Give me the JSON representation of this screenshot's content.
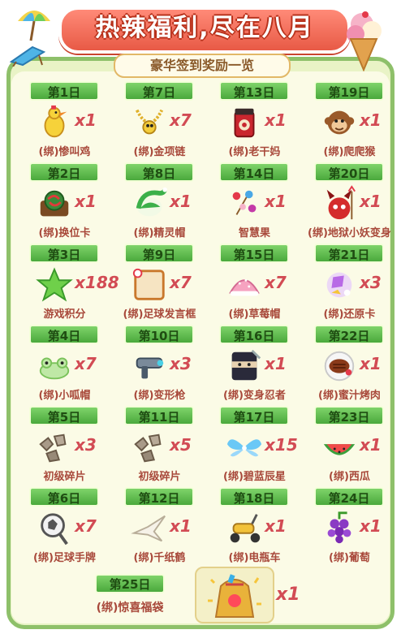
{
  "header": {
    "title": "热辣福利,尽在八月",
    "subtitle": "豪华签到奖励一览"
  },
  "colors": {
    "day_tag": "#4aa93c",
    "qty_text": "#d24b54",
    "name_text": "#a8483a",
    "banner": "#e85a46",
    "frame": "#8ec06a"
  },
  "rewards": [
    {
      "day": "第1日",
      "name": "(绑)惨叫鸡",
      "qty": "x1",
      "icon": "rubber-chicken-icon"
    },
    {
      "day": "第7日",
      "name": "(绑)金项链",
      "qty": "x7",
      "icon": "gold-necklace-icon"
    },
    {
      "day": "第13日",
      "name": "(绑)老干妈",
      "qty": "x1",
      "icon": "chili-sauce-jar-icon"
    },
    {
      "day": "第19日",
      "name": "(绑)爬爬猴",
      "qty": "x1",
      "icon": "monkey-icon"
    },
    {
      "day": "第2日",
      "name": "(绑)换位卡",
      "qty": "x1",
      "icon": "swap-card-icon"
    },
    {
      "day": "第8日",
      "name": "(绑)精灵帽",
      "qty": "x1",
      "icon": "elf-hat-icon"
    },
    {
      "day": "第14日",
      "name": "智慧果",
      "qty": "x1",
      "icon": "wisdom-fruit-icon"
    },
    {
      "day": "第20日",
      "name": "(绑)地狱小妖变身",
      "qty": "x1",
      "icon": "little-devil-icon"
    },
    {
      "day": "第3日",
      "name": "游戏积分",
      "qty": "x188",
      "icon": "green-star-icon"
    },
    {
      "day": "第9日",
      "name": "(绑)足球发言框",
      "qty": "x7",
      "icon": "chat-frame-icon"
    },
    {
      "day": "第15日",
      "name": "(绑)草莓帽",
      "qty": "x7",
      "icon": "strawberry-hat-icon"
    },
    {
      "day": "第21日",
      "name": "(绑)还原卡",
      "qty": "x3",
      "icon": "restore-card-icon"
    },
    {
      "day": "第4日",
      "name": "(绑)小呱帽",
      "qty": "x7",
      "icon": "frog-hat-icon"
    },
    {
      "day": "第10日",
      "name": "(绑)变形枪",
      "qty": "x3",
      "icon": "transform-gun-icon"
    },
    {
      "day": "第16日",
      "name": "(绑)变身忍者",
      "qty": "x1",
      "icon": "ninja-icon"
    },
    {
      "day": "第22日",
      "name": "(绑)蜜汁烤肉",
      "qty": "x1",
      "icon": "roast-meat-icon"
    },
    {
      "day": "第5日",
      "name": "初级碎片",
      "qty": "x3",
      "icon": "fragment-icon"
    },
    {
      "day": "第11日",
      "name": "初级碎片",
      "qty": "x5",
      "icon": "fragment-icon"
    },
    {
      "day": "第17日",
      "name": "(绑)碧蓝辰星",
      "qty": "x15",
      "icon": "blue-wings-icon"
    },
    {
      "day": "第23日",
      "name": "(绑)西瓜",
      "qty": "x1",
      "icon": "watermelon-icon"
    },
    {
      "day": "第6日",
      "name": "(绑)足球手牌",
      "qty": "x7",
      "icon": "football-sign-icon"
    },
    {
      "day": "第12日",
      "name": "(绑)千纸鹤",
      "qty": "x1",
      "icon": "paper-crane-icon"
    },
    {
      "day": "第18日",
      "name": "(绑)电瓶车",
      "qty": "x1",
      "icon": "scooter-icon"
    },
    {
      "day": "第24日",
      "name": "(绑)葡萄",
      "qty": "x1",
      "icon": "grape-icon"
    }
  ],
  "final_reward": {
    "day": "第25日",
    "name": "(绑)惊喜福袋",
    "qty": "x1",
    "icon": "lucky-bag-icon"
  }
}
